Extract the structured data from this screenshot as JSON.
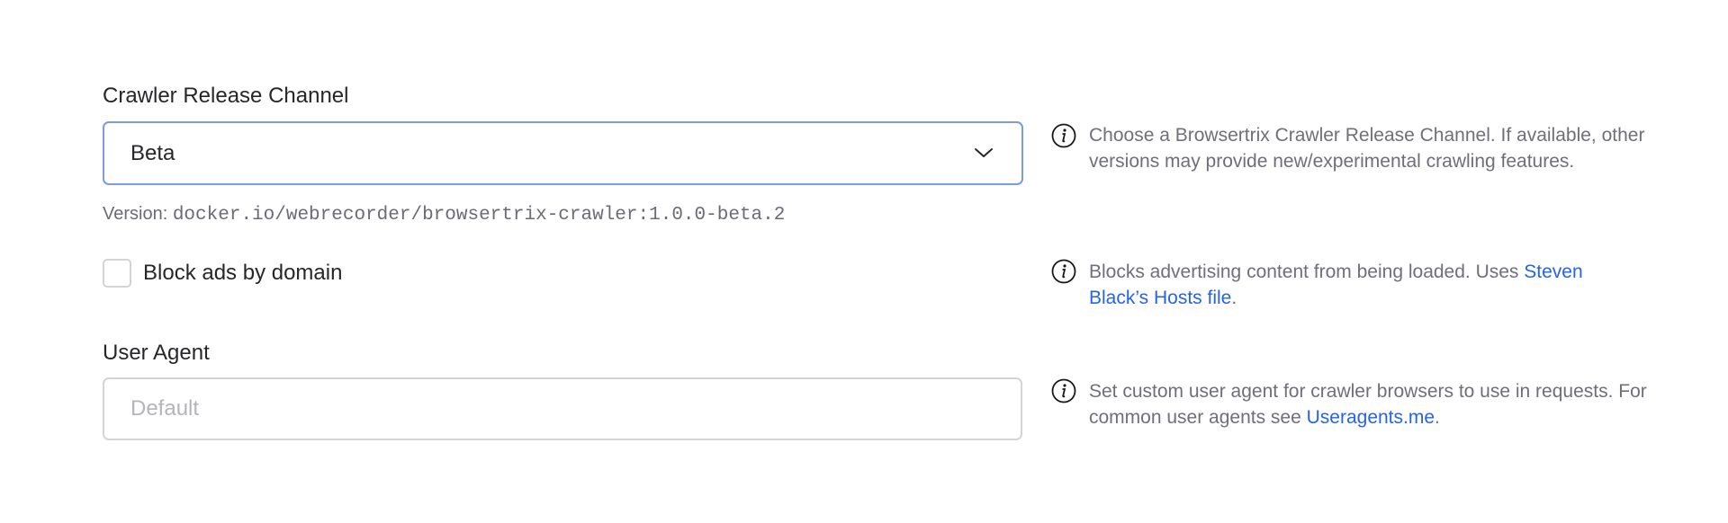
{
  "release_channel": {
    "label": "Crawler Release Channel",
    "selected_value": "Beta",
    "version_prefix": "Version:",
    "version_image": "docker.io/webrecorder/browsertrix-crawler:1.0.0-beta.2",
    "help_text": "Choose a Browsertrix Crawler Release Channel. If available, other versions may provide new/experimental crawling features."
  },
  "block_ads": {
    "label": "Block ads by domain",
    "checked": false,
    "help_text_before": "Blocks advertising content from being loaded. Uses ",
    "help_link": "Steven Black’s Hosts file",
    "help_text_after": "."
  },
  "user_agent": {
    "label": "User Agent",
    "value": "",
    "placeholder": "Default",
    "help_text_before": "Set custom user agent for crawler browsers to use in requests. For common user agents see ",
    "help_link": "Useragents.me",
    "help_text_after": "."
  },
  "icons": {
    "info": "info-circle-icon",
    "chevron": "chevron-down-icon"
  },
  "colors": {
    "text": "#27272a",
    "muted": "#6f6f77",
    "link": "#2563eb",
    "focus_border": "#7c9be3",
    "border": "#d4d4d8",
    "placeholder": "#b4b4bb"
  }
}
